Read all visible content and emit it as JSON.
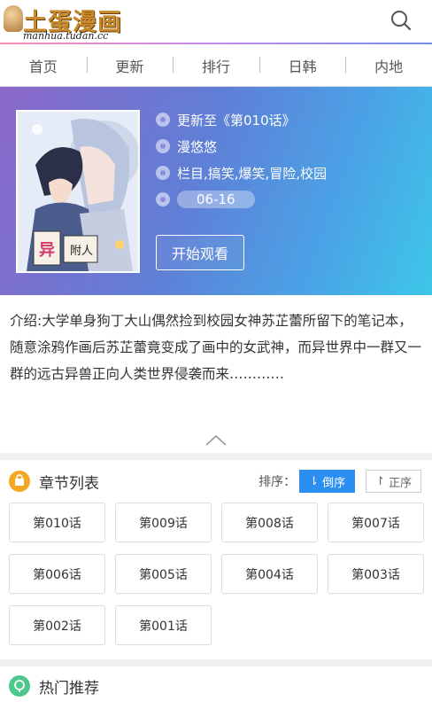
{
  "header": {
    "logo_text": "土蛋漫画",
    "logo_sub": "manhua.tudan.cc",
    "search_icon": "search-icon"
  },
  "nav": {
    "items": [
      {
        "label": "首页"
      },
      {
        "label": "更新"
      },
      {
        "label": "排行"
      },
      {
        "label": "日韩"
      },
      {
        "label": "内地"
      }
    ]
  },
  "comic": {
    "latest": "更新至《第010话》",
    "author": "漫悠悠",
    "tags": "栏目,搞笑,爆笑,冒险,校园",
    "date": "06-16",
    "cover_label": "异 附 人",
    "watch_label": "开始观看"
  },
  "intro": {
    "text": "介绍:大学单身狗丁大山偶然捡到校园女神苏芷蕾所留下的笔记本，随意涂鸦作画后苏芷蕾竟变成了画中的女武神，而异世界中一群又一群的远古异兽正向人类世界侵袭而来…………"
  },
  "chapters": {
    "title": "章节列表",
    "sort_label": "排序：",
    "sort_desc": "倒序",
    "sort_asc": "正序",
    "list": [
      {
        "label": "第010话"
      },
      {
        "label": "第009话"
      },
      {
        "label": "第008话"
      },
      {
        "label": "第007话"
      },
      {
        "label": "第006话"
      },
      {
        "label": "第005话"
      },
      {
        "label": "第004话"
      },
      {
        "label": "第003话"
      },
      {
        "label": "第002话"
      },
      {
        "label": "第001话"
      }
    ]
  },
  "hot": {
    "title": "热门推荐"
  },
  "colors": {
    "accent_blue": "#2a8ff0",
    "chapter_icon": "#f5a623",
    "hot_icon": "#4cc98a"
  }
}
